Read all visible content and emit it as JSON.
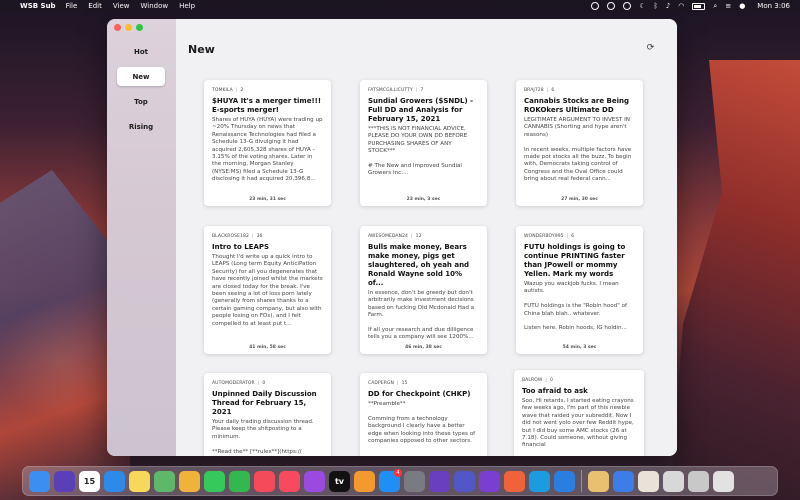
{
  "menubar": {
    "app_name": "WSB Sub",
    "menus": [
      "File",
      "Edit",
      "View",
      "Window",
      "Help"
    ],
    "clock": "Mon 3:06"
  },
  "sidebar": {
    "items": [
      {
        "label": "Hot",
        "active": false
      },
      {
        "label": "New",
        "active": true
      },
      {
        "label": "Top",
        "active": false
      },
      {
        "label": "Rising",
        "active": false
      }
    ]
  },
  "main": {
    "title": "New",
    "refresh_icon": "refresh-icon"
  },
  "posts": [
    {
      "author": "TOMKILA",
      "comments": "2",
      "title": "$HUYA It's a merger time!!! E-sports merger!",
      "body": "Shares of HUYA (HUYA) were trading up ~20% Thursday on news that Renaissance Technologies had filed a Schedule 13-G divulging it had acquired 2,605,328 shares of HUYA - 3.15% of the voting shares. Later in the morning, Morgan Stanley (NYSE:MS) filed a Schedule 13-G disclosing it had acquired 20,396,8...",
      "duration": "23 min, 31 sec"
    },
    {
      "author": "FATSMCGILLICUTTY",
      "comments": "7",
      "title": "Sundial Growers ($SNDL) - Full DD and Analysis for February 15, 2021",
      "body": "***THIS IS NOT FINANCIAL ADVICE, PLEASE DO YOUR OWN DD BEFORE PURCHASING SHARES OF ANY STOCK***\n\n# The New and Improved Sundial Growers Inc....",
      "duration": "23 min, 3 sec"
    },
    {
      "author": "BRAJ728",
      "comments": "6",
      "title": "Cannabis Stocks are Being ROKOkers Ultimate DD",
      "body": "LEGITIMATE ARGUMENT TO INVEST IN CANNABIS (Shorting and hype aren't reasons)\n\nIn recent weeks, multiple factors have made pot stocks all the buzz. To begin with, Democrats taking control of Congress and the Oval Office could bring about real federal cann...",
      "duration": "27 min, 30 sec"
    },
    {
      "author": "BLACKROSE182",
      "comments": "36",
      "title": "Intro to LEAPS",
      "body": "Thought I'd write up a quick intro to LEAPS (Long term Equity AnticiPation Security) for all you degenerates that have recently joined whilst the markets are closed today for the break. I've been seeing a lot of loss porn lately (generally from shares thanks to a certain gaming company, but also with people losing on FDs), and I felt compelled to at least put t...",
      "duration": "41 min, 58 sec"
    },
    {
      "author": "AWESOMEDAN24",
      "comments": "12",
      "title": "Bulls make money, Bears make money, pigs get slaughtered, oh yeah and Ronald Wayne sold 10% of...",
      "body": "In essence, don't be greedy but don't arbitrarily make investment decisions based on fucking Old Mcdonald Had a Farm.\n\nIf all your research and due dilligence tells you a company will see 1200%...",
      "duration": "46 min, 38 sec"
    },
    {
      "author": "WONDERBOY995",
      "comments": "6",
      "title": "FUTU holdings is going to continue PRINTING faster than JPowell or mommy Yellen. Mark my words",
      "body": "Wazup you wackjob fucks. I mean autists.\n\nFUTU holdings is the \"Robin hood\" of China blah blah.. whatever.\n\nListen here. Robin hoods, IG holdin...",
      "duration": "54 min, 3 sec"
    },
    {
      "author": "AUTOMODERATOR",
      "comments": "0",
      "title": "Unpinned Daily Discussion Thread for February 15, 2021",
      "body": "Your daily trading discussion thread. Please keep the shitposting to a minimum.\n\n**Read the** [**rules**](https:// www.reddit.com/r/wallstreetbets/wiki/",
      "duration": ""
    },
    {
      "author": "CADPERGN",
      "comments": "15",
      "title": "DD for Checkpoint (CHKP)",
      "body": "**Preamble**\n\nComming from a technology background I clearly have a better edge when looking into these types of companies opposed to other sectors.",
      "duration": ""
    },
    {
      "author": "BALROW",
      "comments": "0",
      "title": "Too afraid to ask",
      "body": "Soo, Hi retards, I started eating crayons few weeks ago, I'm part of this newbie wave that raided your subreddit. Now I did not went yolo over few Reddit hype, but I did buy some AMC stocks (26 at 7.18). Could someone, without giving financial",
      "duration": ""
    }
  ],
  "dock": {
    "items": [
      {
        "name": "finder-icon",
        "color": "#3b8ff0"
      },
      {
        "name": "siri-icon",
        "color": "#5b3fb8"
      },
      {
        "name": "calendar-icon",
        "color": "#ffffff",
        "label": "15"
      },
      {
        "name": "safari-icon",
        "color": "#2d8ae8"
      },
      {
        "name": "notes-icon",
        "color": "#f7d85a"
      },
      {
        "name": "maps-icon",
        "color": "#5fb86a"
      },
      {
        "name": "photos-icon",
        "color": "#f0b23a"
      },
      {
        "name": "messages-icon",
        "color": "#35c85a"
      },
      {
        "name": "facetime-icon",
        "color": "#33b850"
      },
      {
        "name": "news-icon",
        "color": "#f44a5a"
      },
      {
        "name": "music-icon",
        "color": "#f8495e"
      },
      {
        "name": "podcasts-icon",
        "color": "#9b4ae0"
      },
      {
        "name": "tv-icon",
        "color": "#111111",
        "label": "tv"
      },
      {
        "name": "books-icon",
        "color": "#f3992d"
      },
      {
        "name": "app-store-icon",
        "color": "#1f8ff5",
        "badge": "4"
      },
      {
        "name": "system-preferences-icon",
        "color": "#7a7a82"
      },
      {
        "name": "obsidian-icon",
        "color": "#6a3fbf"
      },
      {
        "name": "linear-icon",
        "color": "#5257c8"
      },
      {
        "name": "feedback-icon",
        "color": "#7a3fd0"
      },
      {
        "name": "swift-playgrounds-icon",
        "color": "#f0623a"
      },
      {
        "name": "skype-icon",
        "color": "#1c9be0"
      },
      {
        "name": "xcode-icon",
        "color": "#2a7ee0"
      },
      {
        "name": "finder-face-icon",
        "color": "#e8c070"
      },
      {
        "name": "document-icon",
        "color": "#3c7de8"
      },
      {
        "name": "preview-icon",
        "color": "#e8e2d8"
      },
      {
        "name": "file-icon",
        "color": "#d8d8d8"
      },
      {
        "name": "screenshot-icon",
        "color": "#c8c8c8"
      },
      {
        "name": "trash-icon",
        "color": "#e2e2e2"
      }
    ]
  }
}
